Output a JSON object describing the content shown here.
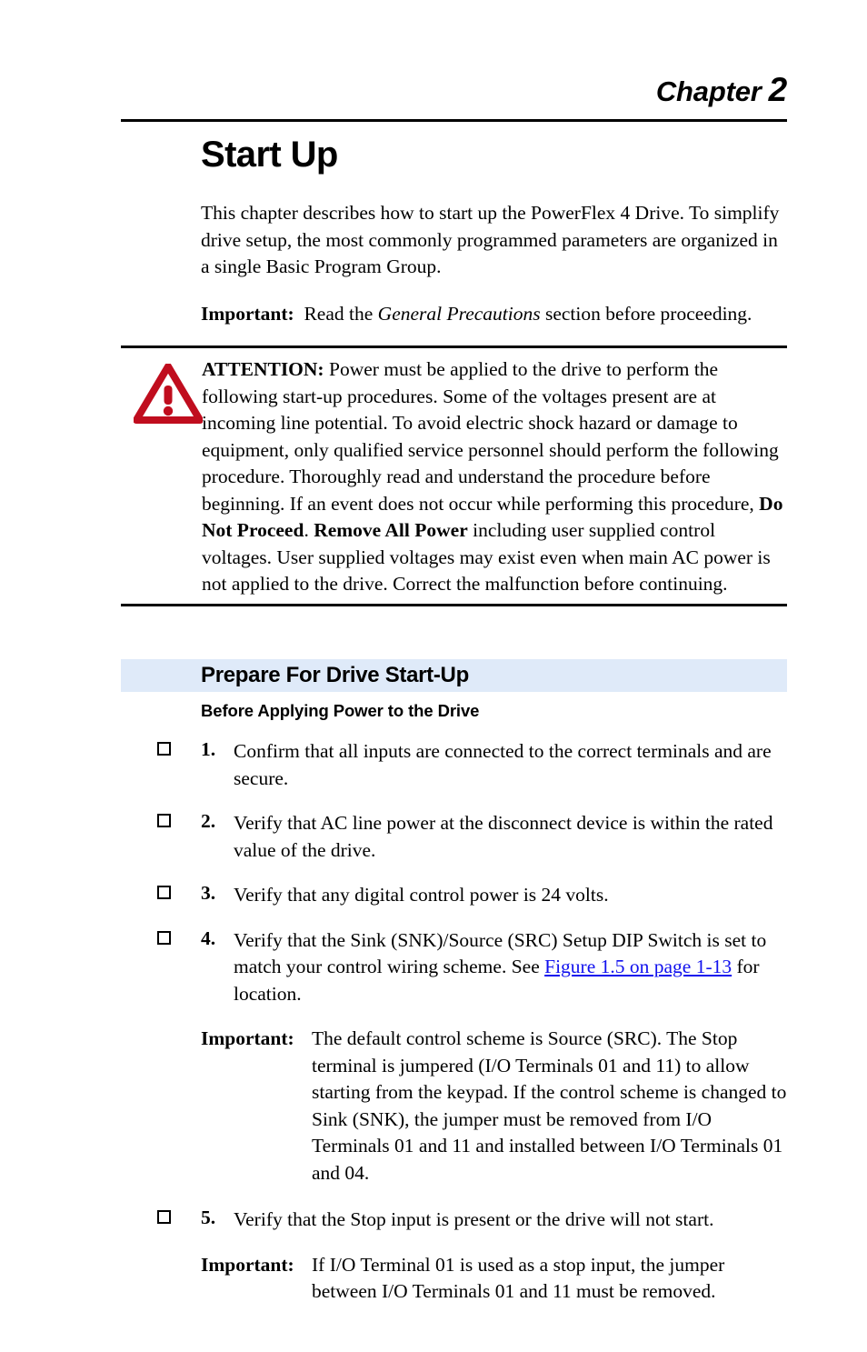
{
  "header": {
    "chapter_word": "Chapter",
    "chapter_number": "2"
  },
  "page_title": "Start Up",
  "intro": {
    "paragraph": "This chapter describes how to start up the PowerFlex 4 Drive. To simplify drive setup, the most commonly programmed parameters are organized in a single Basic Program Group.",
    "important_label": "Important:",
    "important_text_before": "Read the ",
    "important_text_italic": "General Precautions",
    "important_text_after": " section before proceeding."
  },
  "attention": {
    "label": "ATTENTION:",
    "icon": "warning-triangle-icon",
    "icon_color": "#c00d1e",
    "text_part_1": "  Power must be applied to the drive to perform the following start-up procedures. Some of the voltages present are at incoming line potential. To avoid electric shock hazard or damage to equipment, only qualified service personnel should perform the following procedure. Thoroughly read and understand the procedure before beginning. If an event does not occur while performing this procedure, ",
    "bold_1": "Do Not Proceed",
    "text_part_2": ". ",
    "bold_2": "Remove All Power",
    "text_part_3": " including user supplied control voltages. User supplied voltages may exist even when main AC power is not applied to the drive. Correct the malfunction before continuing."
  },
  "section": {
    "heading": "Prepare For Drive Start-Up",
    "band_color": "#dfeaf9",
    "subheading": "Before Applying Power to the Drive"
  },
  "checklist": [
    {
      "number": "1.",
      "text": "Confirm that all inputs are connected to the correct terminals and are secure."
    },
    {
      "number": "2.",
      "text": "Verify that AC line power at the disconnect device is within the rated value of the drive."
    },
    {
      "number": "3.",
      "text": "Verify that any digital control power is 24 volts."
    },
    {
      "number": "4.",
      "text_before_link": "Verify that the Sink (SNK)/Source (SRC) Setup DIP Switch is set to match your control wiring scheme. See ",
      "link_text": "Figure 1.5 on page 1-13",
      "link_color": "#1111ee",
      "text_after_link": " for location."
    },
    {
      "number": "5.",
      "text": "Verify that the Stop input is present or the drive will not start."
    }
  ],
  "important_blocks": {
    "after_item_4": {
      "label": "Important:",
      "text": "The default control scheme is Source (SRC). The Stop terminal is jumpered (I/O Terminals 01 and 11) to allow starting from the keypad. If the control scheme is changed to Sink (SNK), the jumper must be removed from I/O Terminals 01 and 11 and installed between I/O Terminals 01 and 04."
    },
    "after_item_5": {
      "label": "Important:",
      "text": "If I/O Terminal 01 is used as a stop input, the jumper between I/O Terminals 01 and 11 must be removed."
    }
  }
}
